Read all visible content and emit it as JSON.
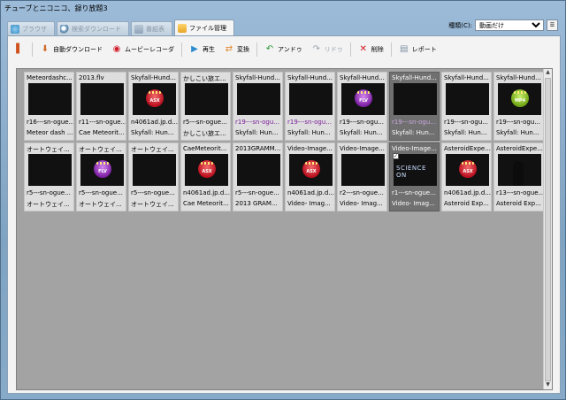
{
  "window": {
    "title": "チューブとニコニコ、録り放題3"
  },
  "tabs": [
    {
      "label": "ブラウザ",
      "active": false
    },
    {
      "label": "検索ダウンロード",
      "active": false
    },
    {
      "label": "番組表",
      "active": false
    },
    {
      "label": "ファイル管理",
      "active": true
    }
  ],
  "kind": {
    "label": "種類(C):",
    "value": "動画だけ"
  },
  "toolbar": {
    "auto_download": "自動ダウンロード",
    "movie_recorder": "ムービーレコーダ",
    "play": "再生",
    "convert": "変換",
    "undo": "アンドゥ",
    "redo": "リドゥ",
    "delete": "削除",
    "report": "レポート"
  },
  "files": [
    {
      "name": "Meteordashc...",
      "id": "r16---sn-ogue...",
      "title": "Meteor dash ...",
      "thumb": "meteor"
    },
    {
      "name": "2013.flv",
      "id": "r11---sn-ogue...",
      "title": "Cae Meteorit...",
      "thumb": "clock"
    },
    {
      "name": "Skyfall-Hund...",
      "id": "n4061ad.jp.d...",
      "title": "Skyfall: Hun...",
      "thumb": "asx"
    },
    {
      "name": "かしこい旅エ...",
      "id": "r5---sn-ogue...",
      "title": "かしこい旅エ...",
      "thumb": "crab"
    },
    {
      "name": "Skyfall-Hund...",
      "id": "r19---sn-ogu...",
      "title": "Skyfall: Hun...",
      "thumb": "news",
      "id_purple": true
    },
    {
      "name": "Skyfall-Hund...",
      "id": "r19---sn-ogu...",
      "title": "Skyfall: Hun...",
      "thumb": "news",
      "id_purple": true
    },
    {
      "name": "Skyfall-Hund...",
      "id": "r19---sn-ogu...",
      "title": "Skyfall: Hun...",
      "thumb": "flv"
    },
    {
      "name": "Skyfall-Hund...",
      "id": "r19---sn-ogu...",
      "title": "Skyfall: Hun...",
      "thumb": "black",
      "selected": true,
      "id_purple": true
    },
    {
      "name": "Skyfall-Hund...",
      "id": "r19---sn-ogu...",
      "title": "Skyfall: Hun...",
      "thumb": "news"
    },
    {
      "name": "Skyfall-Hund...",
      "id": "r19---sn-ogu...",
      "title": "Skyfall: Hun...",
      "thumb": "mp4"
    },
    {
      "name": "オートウェイ...",
      "id": "r5---sn-ogue...",
      "title": "オートウェイ...",
      "thumb": "black"
    },
    {
      "name": "オートウェイ...",
      "id": "r5---sn-ogue...",
      "title": "オートウェイ...",
      "thumb": "flv"
    },
    {
      "name": "オートウェイ...",
      "id": "r5---sn-ogue...",
      "title": "オートウェイ...",
      "thumb": "black"
    },
    {
      "name": "CaeMeteorit...",
      "id": "n4061ad.jp.d...",
      "title": "Cae Meteorit...",
      "thumb": "asx"
    },
    {
      "name": "2013GRAMM...",
      "id": "r5---sn-ogue...",
      "title": "2013 GRAM...",
      "thumb": "pattern"
    },
    {
      "name": "Video-Image...",
      "id": "n4061ad.jp.d...",
      "title": "Video- Imag...",
      "thumb": "asx"
    },
    {
      "name": "Video-Image...",
      "id": "r2---sn-ogue...",
      "title": "Video- Imag...",
      "thumb": "fire"
    },
    {
      "name": "Video-Image...",
      "id": "r1---sn-ogue...",
      "title": "Video- Imag...",
      "thumb": "science",
      "selected": true,
      "checked": true,
      "science_text": "SCIENCE ON"
    },
    {
      "name": "AsteroidExpe...",
      "id": "n4061ad.jp.d...",
      "title": "Asteroid Exp...",
      "thumb": "asx"
    },
    {
      "name": "AsteroidExpe...",
      "id": "r13---sn-ogue...",
      "title": "Asteroid Exp...",
      "thumb": "anchor"
    }
  ],
  "thumb_labels": {
    "asx": "ASX",
    "flv": "FLV",
    "mp4": "MP4",
    "clock": "3"
  },
  "colors": {
    "selected_tile": "#707070",
    "purple_text": "#7a1c9a"
  }
}
